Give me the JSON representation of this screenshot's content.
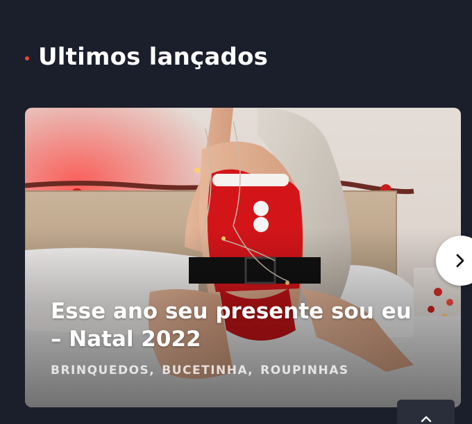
{
  "section": {
    "title": "Ultimos lançados"
  },
  "card": {
    "title": "Esse ano seu presente sou eu – Natal 2022",
    "tags": [
      "BRINQUEDOS",
      "BUCETINHA",
      "ROUPINHAS"
    ]
  },
  "icons": {
    "next": "chevron-right-icon",
    "scroll_top": "chevron-up-icon"
  },
  "colors": {
    "background": "#1b1f2b",
    "accent_dot": "#e8453c",
    "button_bg": "#ffffff"
  }
}
